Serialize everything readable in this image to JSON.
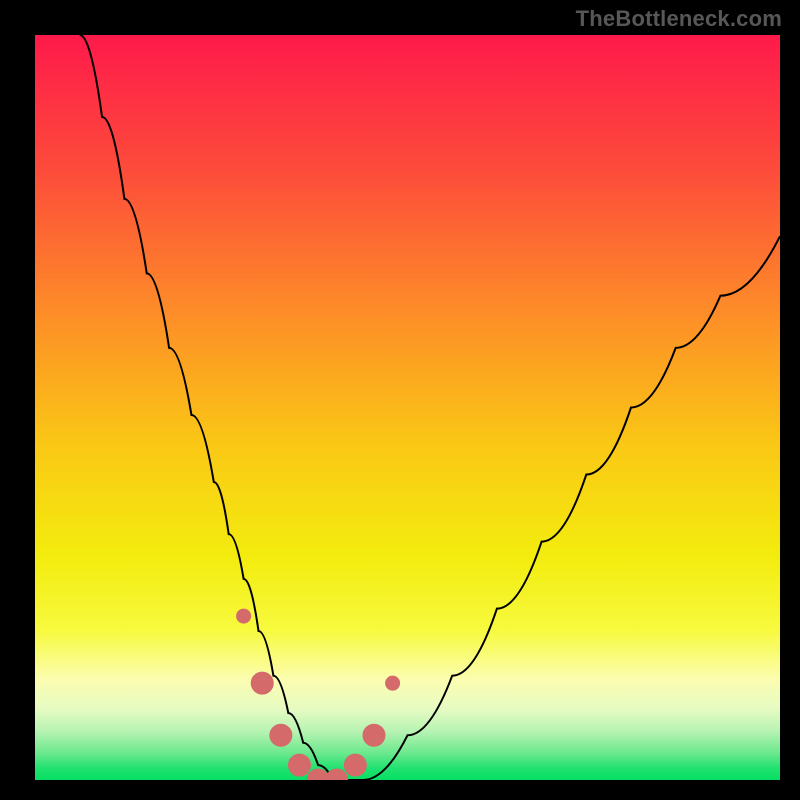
{
  "watermark": {
    "text": "TheBottleneck.com"
  },
  "colors": {
    "frame": "#000000",
    "curve_stroke": "#000000",
    "marker_fill": "#d46a6a",
    "marker_stroke": "#d46a6a",
    "gradient_stops": [
      {
        "offset": 0.0,
        "color": "#fe1a4a"
      },
      {
        "offset": 0.18,
        "color": "#fd4b3b"
      },
      {
        "offset": 0.38,
        "color": "#fd8f27"
      },
      {
        "offset": 0.55,
        "color": "#fac815"
      },
      {
        "offset": 0.7,
        "color": "#f3ec0e"
      },
      {
        "offset": 0.8,
        "color": "#f7fa3f"
      },
      {
        "offset": 0.865,
        "color": "#fbfdb0"
      },
      {
        "offset": 0.905,
        "color": "#e6fbc2"
      },
      {
        "offset": 0.935,
        "color": "#b6f3b2"
      },
      {
        "offset": 0.965,
        "color": "#68e88c"
      },
      {
        "offset": 0.985,
        "color": "#1ee26f"
      },
      {
        "offset": 1.0,
        "color": "#06df63"
      }
    ]
  },
  "chart_data": {
    "type": "line",
    "title": "",
    "xlabel": "",
    "ylabel": "",
    "ylim": [
      0,
      100
    ],
    "xlim": [
      0,
      100
    ],
    "series": [
      {
        "name": "bottleneck-curve",
        "x": [
          6,
          9,
          12,
          15,
          18,
          21,
          24,
          26,
          28,
          30,
          32,
          34,
          36,
          38,
          40,
          44,
          50,
          56,
          62,
          68,
          74,
          80,
          86,
          92,
          100
        ],
        "y": [
          100,
          89,
          78,
          68,
          58,
          49,
          40,
          33,
          27,
          20,
          14,
          9,
          5,
          2,
          0,
          0,
          6,
          14,
          23,
          32,
          41,
          50,
          58,
          65,
          73
        ]
      }
    ],
    "markers": {
      "name": "highlighted-range",
      "x": [
        28,
        30.5,
        33,
        35.5,
        38,
        40.5,
        43,
        45.5,
        48
      ],
      "y": [
        22,
        13,
        6,
        2,
        0,
        0,
        2,
        6,
        13
      ],
      "radius_px": [
        7,
        11,
        11,
        11,
        11,
        11,
        11,
        11,
        7
      ]
    }
  }
}
